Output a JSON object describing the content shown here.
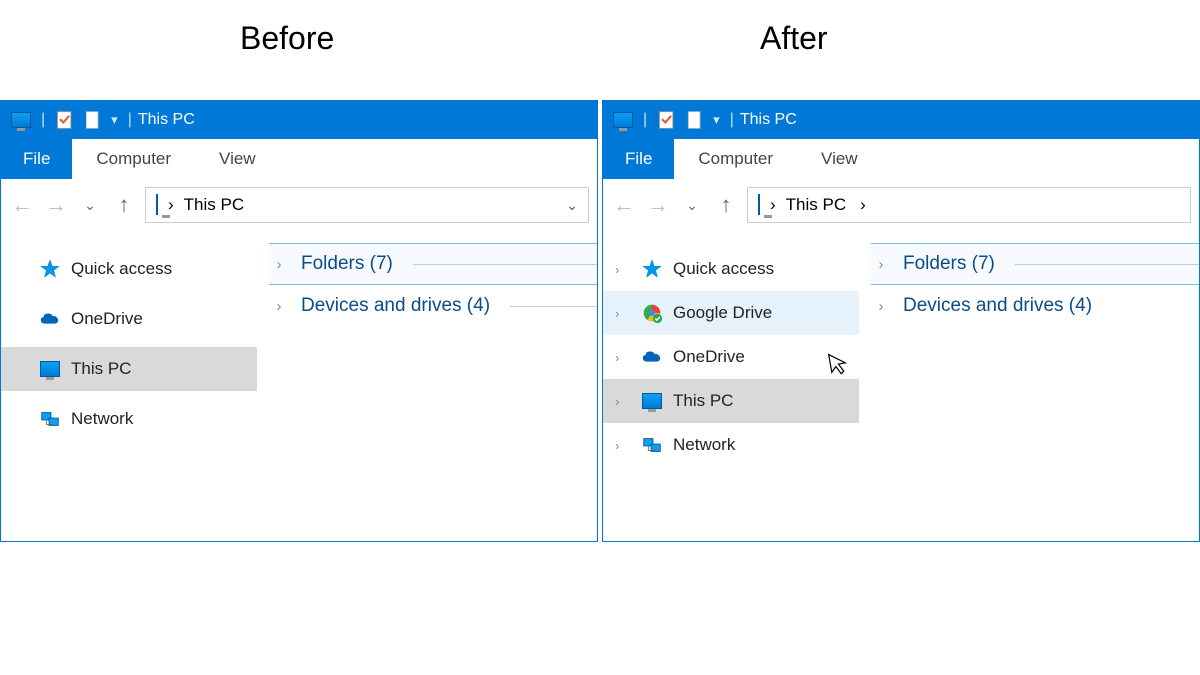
{
  "labels": {
    "before": "Before",
    "after": "After"
  },
  "titlebar": {
    "title": "This PC",
    "divider": " | "
  },
  "menubar": {
    "file": "File",
    "computer": "Computer",
    "view": "View"
  },
  "address": {
    "label": "This PC",
    "sep": "›"
  },
  "sections": {
    "folders": "Folders (7)",
    "devices": "Devices and drives (4)"
  },
  "sidebar_before": [
    {
      "label": "Quick access",
      "icon": "star"
    },
    {
      "label": "OneDrive",
      "icon": "cloud"
    },
    {
      "label": "This PC",
      "icon": "monitor",
      "selected": true
    },
    {
      "label": "Network",
      "icon": "network"
    }
  ],
  "sidebar_after": [
    {
      "label": "Quick access",
      "icon": "star"
    },
    {
      "label": "Google Drive",
      "icon": "gdrive",
      "hover": true
    },
    {
      "label": "OneDrive",
      "icon": "cloud"
    },
    {
      "label": "This PC",
      "icon": "monitor",
      "selected": true
    },
    {
      "label": "Network",
      "icon": "network"
    }
  ]
}
